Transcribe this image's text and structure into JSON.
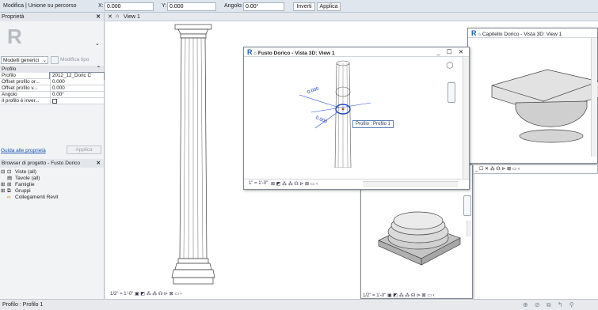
{
  "options_bar": {
    "mode": "Modifica | Unione su percorso",
    "x_label": "X:",
    "x_value": "0.000",
    "y_label": "Y:",
    "y_value": "0.000",
    "angle_label": "Angolo:",
    "angle_value": "0.00°",
    "invert_button": "Inverti",
    "apply_button": "Applica"
  },
  "properties": {
    "header": "Proprietà",
    "close": "✕",
    "type_selector": "Modelli generici",
    "edit_type": "Modifica tipo",
    "section": "Profilo",
    "rows": [
      {
        "key": "Profilo",
        "value": "2012_12_Doric C"
      },
      {
        "key": "Offset profilo or...",
        "value": "0.000"
      },
      {
        "key": "Offset profilo v...",
        "value": "0.000"
      },
      {
        "key": "Angolo",
        "value": "0.00°"
      },
      {
        "key": "Il profilo è inver...",
        "value": ""
      }
    ],
    "help_link": "Guida alle proprietà",
    "apply": "Applica"
  },
  "browser": {
    "header": "Browser di progetto - Fusto Dorico",
    "close": "✕",
    "items": [
      {
        "label": "Viste (all)",
        "icon": "⊡",
        "expander": "⊟"
      },
      {
        "label": "Tavole (all)",
        "icon": "▤",
        "expander": ""
      },
      {
        "label": "Famiglie",
        "icon": "⊞",
        "expander": "⊞"
      },
      {
        "label": "Gruppi",
        "icon": "⧉",
        "expander": "⊞"
      },
      {
        "label": "Collegamenti Revit",
        "icon": "∞",
        "expander": ""
      }
    ]
  },
  "main_view": {
    "tab_label": "View 1",
    "scale": "1/2\" = 1'-0\"",
    "view_icons": "▣ ◩ ⁂ ⁂ ☊ ⊳ ⊠ ▭ ‹"
  },
  "window_fusto": {
    "title": "Fusto Dorico - Vista 3D: View 1",
    "controls": "_ ☐ ✕",
    "dim1": "0.000",
    "dim2": "0.000",
    "tooltip": "Profilo : Profilo 1",
    "scale": "1\" = 1'-0\"",
    "view_icons": "⊠ ◩ ⁂ ⁂ ☊ ⊳ ⊠ ▭ ‹"
  },
  "window_capitello": {
    "title": "Capitello Dorico - Vista 3D: View 1",
    "view_icons": "_ ☐ ✕ ⁂ ☊ ⊳ ⊠ ▭ ‹"
  },
  "window_base": {
    "scale": "1/2\" = 1'-0\"",
    "view_icons": "▣ ◩ ⁂ ⁂ ☊ ⊳ ⊠ ▭ ‹"
  },
  "status": {
    "text": "Profilo : Profilo 1"
  }
}
